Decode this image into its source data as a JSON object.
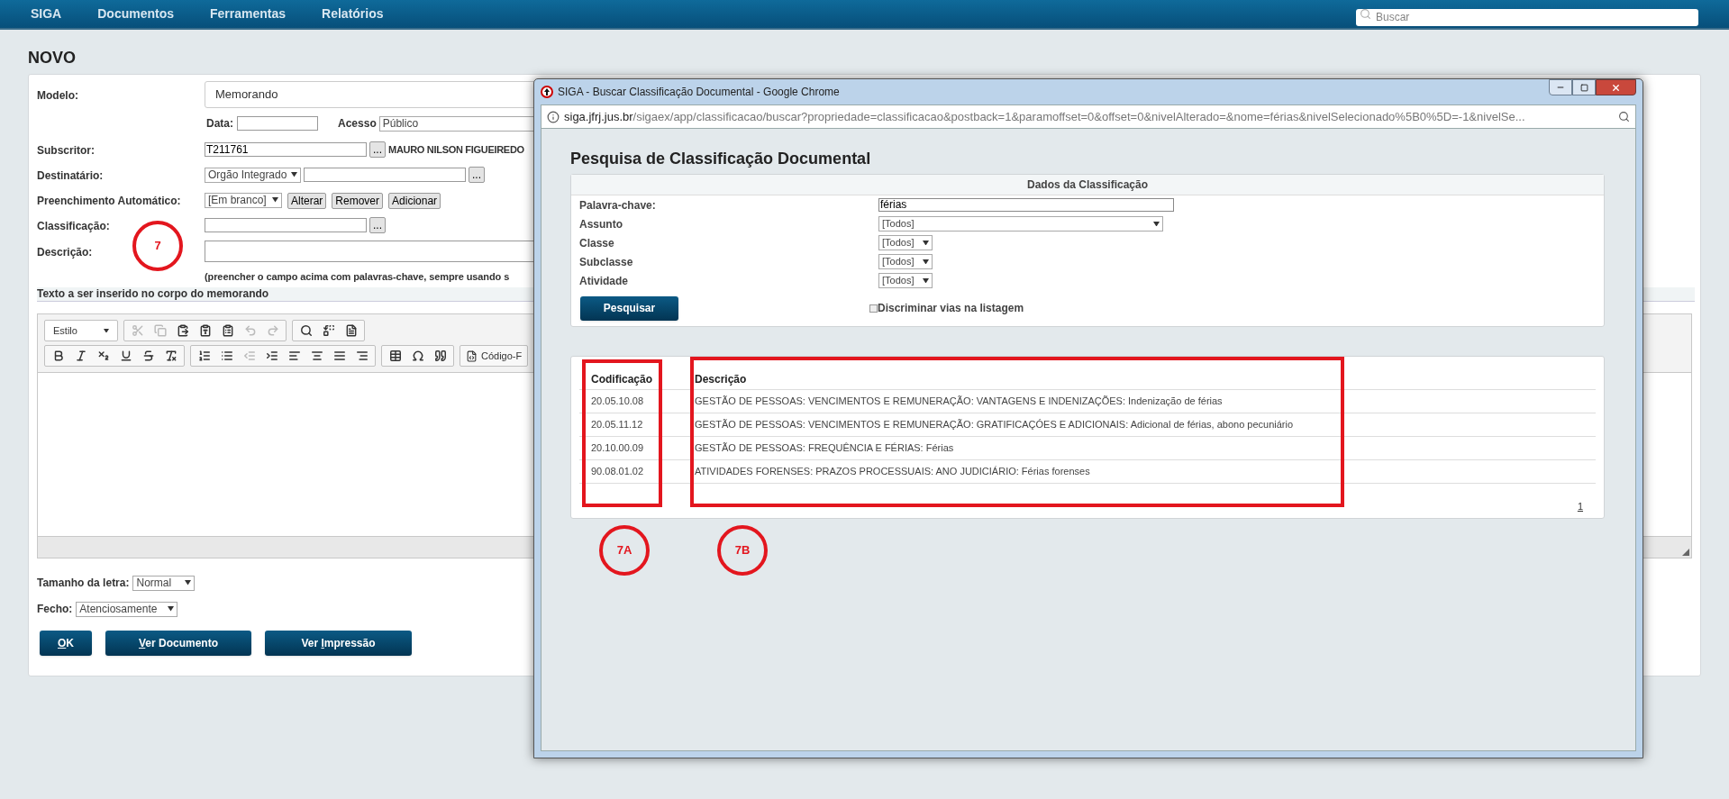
{
  "nav": {
    "items": [
      "SIGA",
      "Documentos",
      "Ferramentas",
      "Relatórios"
    ],
    "search": {
      "placeholder": "Buscar"
    }
  },
  "title": "NOVO",
  "form": {
    "modelo": {
      "label": "Modelo:",
      "value": "Memorando"
    },
    "data": {
      "label": "Data:"
    },
    "acesso": {
      "label": "Acesso",
      "value": "Público"
    },
    "subscritor": {
      "label": "Subscritor:",
      "value": "T211761",
      "button": "...",
      "name": "MAURO NILSON FIGUEIREDO"
    },
    "destinatario": {
      "label": "Destinatário:",
      "select": "Orgão Integrado",
      "button": "..."
    },
    "preenchimento": {
      "label": "Preenchimento Automático:",
      "select": "[Em branco]",
      "buttons": [
        "Alterar",
        "Remover",
        "Adicionar"
      ]
    },
    "classificacao": {
      "label": "Classificação:",
      "button": "...",
      "annotation": "7"
    },
    "descricao": {
      "label": "Descrição:",
      "hint": "(preencher o campo acima com palavras-chave, sempre usando s"
    }
  },
  "section": "Texto a ser inserido no corpo do memorando",
  "editor": {
    "style_select": "Estilo",
    "toolbar": [
      [
        {
          "kind": "cut",
          "disabled": true
        },
        {
          "kind": "copy",
          "disabled": true
        },
        {
          "kind": "paste",
          "disabled": false
        },
        {
          "kind": "paste-text",
          "disabled": false
        },
        {
          "kind": "paste-word",
          "disabled": false
        },
        {
          "kind": "undo",
          "disabled": true
        },
        {
          "kind": "redo",
          "disabled": true
        }
      ],
      [
        {
          "kind": "find",
          "disabled": false
        },
        {
          "kind": "replace",
          "disabled": false
        },
        {
          "kind": "select-all",
          "disabled": false
        }
      ],
      [
        {
          "kind": "bold",
          "disabled": false
        },
        {
          "kind": "italic",
          "disabled": false
        },
        {
          "kind": "subscript",
          "disabled": false
        },
        {
          "kind": "underline",
          "disabled": false
        },
        {
          "kind": "strike",
          "disabled": false
        },
        {
          "kind": "remove-format",
          "disabled": false
        }
      ],
      [
        {
          "kind": "ordered-list",
          "disabled": false
        },
        {
          "kind": "bullet-list",
          "disabled": false
        },
        {
          "kind": "outdent",
          "disabled": true
        },
        {
          "kind": "indent",
          "disabled": false
        },
        {
          "kind": "align-left",
          "disabled": false
        },
        {
          "kind": "align-center",
          "disabled": false
        },
        {
          "kind": "align-justify",
          "disabled": false
        },
        {
          "kind": "align-right",
          "disabled": false
        }
      ],
      [
        {
          "kind": "table",
          "disabled": false
        },
        {
          "kind": "omega",
          "disabled": false
        },
        {
          "kind": "blockquote",
          "disabled": false
        }
      ]
    ],
    "source_button": "Código-F"
  },
  "tamanho": {
    "label": "Tamanho da letra:",
    "value": "Normal"
  },
  "fecho": {
    "label": "Fecho:",
    "value": "Atenciosamente"
  },
  "buttons": [
    {
      "mnemonic": "O",
      "after": "K"
    },
    {
      "mnemonic": "V",
      "after": "er Documento"
    },
    {
      "before": "Ver ",
      "mnemonic": "I",
      "after": "mpressão"
    }
  ],
  "popup": {
    "title": "SIGA - Buscar Classificação Documental - Google Chrome",
    "url": {
      "host": "siga.jfrj.jus.br",
      "path": "/sigaex/app/classificacao/buscar?propriedade=classificacao&postback=1&paramoffset=0&offset=0&nivelAlterado=&nome=férias&nivelSelecionado%5B0%5D=-1&nivelSe..."
    },
    "heading": "Pesquisa de Classificação Documental",
    "panel_title": "Dados da Classificação",
    "fields": [
      {
        "label": "Palavra-chave:",
        "kind": "text",
        "value": "férias"
      },
      {
        "label": "Assunto",
        "kind": "wide-select",
        "value": "[Todos]"
      },
      {
        "label": "Classe",
        "kind": "select",
        "value": "[Todos]"
      },
      {
        "label": "Subclasse",
        "kind": "select",
        "value": "[Todos]"
      },
      {
        "label": "Atividade",
        "kind": "select",
        "value": "[Todos]"
      }
    ],
    "search_button": "Pesquisar",
    "checkbox": {
      "label": "Discriminar vias na listagem",
      "checked": false
    },
    "results": {
      "columns": [
        "Codificação",
        "Descrição"
      ],
      "rows": [
        [
          "20.05.10.08",
          "GESTÃO DE PESSOAS: VENCIMENTOS E REMUNERAÇÃO: VANTAGENS E INDENIZAÇÕES: Indenização de férias"
        ],
        [
          "20.05.11.12",
          "GESTÃO DE PESSOAS: VENCIMENTOS E REMUNERAÇÃO: GRATIFICAÇÓES E ADICIONAIS: Adicional de férias, abono pecuniário"
        ],
        [
          "20.10.00.09",
          "GESTÃO DE PESSOAS: FREQUÊNCIA E FÉRIAS: Férias"
        ],
        [
          "90.08.01.02",
          "ATIVIDADES FORENSES: PRAZOS PROCESSUAIS: ANO JUDICIÁRIO: Férias forenses"
        ]
      ],
      "pages": [
        "1"
      ],
      "annotations": [
        "7A",
        "7B"
      ]
    }
  }
}
